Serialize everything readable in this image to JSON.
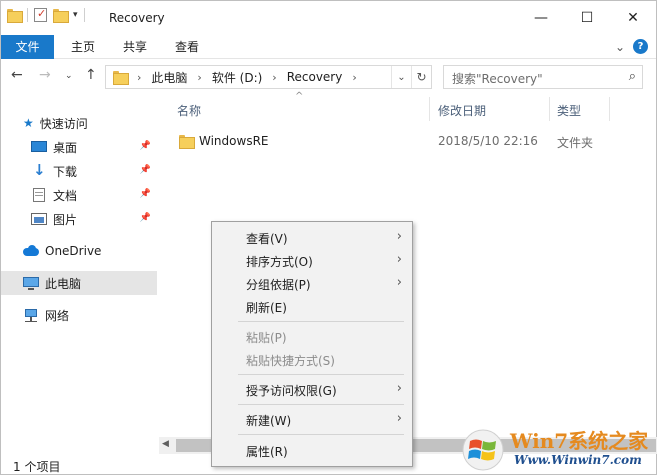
{
  "window": {
    "title": "Recovery",
    "minimize": "—",
    "maximize": "☐",
    "close": "✕"
  },
  "ribbon": {
    "tabs": [
      "文件",
      "主页",
      "共享",
      "查看"
    ],
    "collapse": "⌄"
  },
  "address": {
    "separator": "›",
    "crumbs": [
      "此电脑",
      "软件 (D:)",
      "Recovery"
    ],
    "dropdown": "⌄",
    "refresh": "↻"
  },
  "search": {
    "placeholder": "搜索\"Recovery\""
  },
  "sidebar": {
    "items": [
      {
        "label": "快速访问",
        "icon": "star-icon"
      },
      {
        "label": "桌面",
        "icon": "desktop-icon",
        "pinned": true
      },
      {
        "label": "下载",
        "icon": "download-icon",
        "pinned": true
      },
      {
        "label": "文档",
        "icon": "document-icon",
        "pinned": true
      },
      {
        "label": "图片",
        "icon": "picture-icon",
        "pinned": true
      },
      {
        "label": "OneDrive",
        "icon": "cloud-icon"
      },
      {
        "label": "此电脑",
        "icon": "computer-icon",
        "selected": true
      },
      {
        "label": "网络",
        "icon": "network-icon"
      }
    ]
  },
  "columns": {
    "name": "名称",
    "date": "修改日期",
    "type": "类型"
  },
  "files": [
    {
      "name": "WindowsRE",
      "date": "2018/5/10 22:16",
      "type": "文件夹"
    }
  ],
  "status": {
    "count": "1 个项目"
  },
  "context_menu": {
    "items": [
      {
        "label": "查看(V)",
        "submenu": true,
        "disabled": false
      },
      {
        "label": "排序方式(O)",
        "submenu": true,
        "disabled": false
      },
      {
        "label": "分组依据(P)",
        "submenu": true,
        "disabled": false
      },
      {
        "label": "刷新(E)",
        "submenu": false,
        "disabled": false
      },
      {
        "label": "粘贴(P)",
        "submenu": false,
        "disabled": true
      },
      {
        "label": "粘贴快捷方式(S)",
        "submenu": false,
        "disabled": true
      },
      {
        "label": "授予访问权限(G)",
        "submenu": true,
        "disabled": false
      },
      {
        "label": "新建(W)",
        "submenu": true,
        "disabled": false
      },
      {
        "label": "属性(R)",
        "submenu": false,
        "disabled": false
      }
    ],
    "arrow": "›"
  },
  "watermark": {
    "top": "Win7系统之家",
    "bottom": "Www.Winwin7.com"
  },
  "colors": {
    "accent": "#1979ca",
    "folder": "#f6cf5b",
    "menu_bg": "#f2f2f2"
  }
}
